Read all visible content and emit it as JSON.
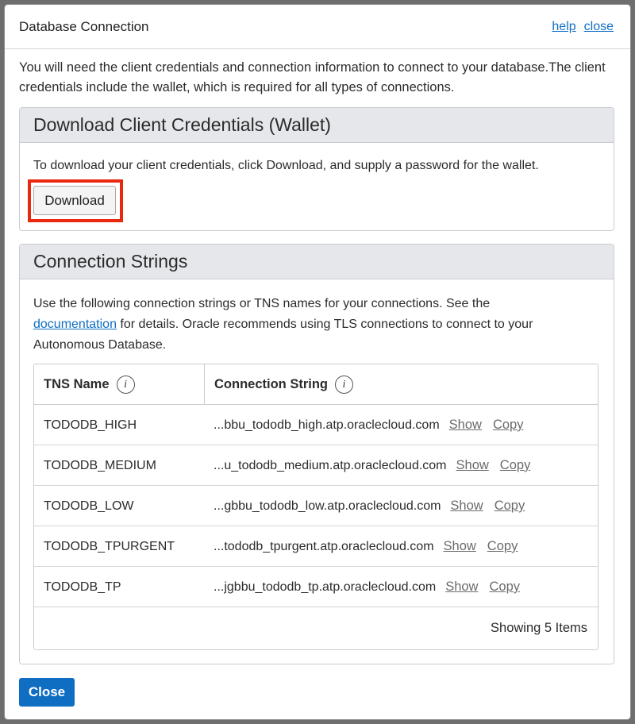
{
  "dialog": {
    "title": "Database Connection",
    "help_link": "help",
    "close_link": "close",
    "intro": "You will need the client credentials and connection information to connect to your database.The client credentials include the wallet, which is required for all types of connections."
  },
  "wallet_panel": {
    "heading": "Download Client Credentials (Wallet)",
    "text": "To download your client credentials, click Download, and supply a password for the wallet.",
    "download_label": "Download"
  },
  "conn_panel": {
    "heading": "Connection Strings",
    "text_before": "Use the following connection strings or TNS names for your connections. See the",
    "doc_link": "documentation",
    "text_after": "for details. Oracle recommends using TLS connections to connect to your Autonomous Database.",
    "columns": {
      "tns_name": "TNS Name",
      "connection_string": "Connection String"
    },
    "info_icon_glyph": "i",
    "rows": [
      {
        "name": "TODODB_HIGH",
        "conn": "...bbu_tododb_high.atp.oraclecloud.com",
        "show": "Show",
        "copy": "Copy"
      },
      {
        "name": "TODODB_MEDIUM",
        "conn": "...u_tododb_medium.atp.oraclecloud.com",
        "show": "Show",
        "copy": "Copy"
      },
      {
        "name": "TODODB_LOW",
        "conn": "...gbbu_tododb_low.atp.oraclecloud.com",
        "show": "Show",
        "copy": "Copy"
      },
      {
        "name": "TODODB_TPURGENT",
        "conn": "...tododb_tpurgent.atp.oraclecloud.com",
        "show": "Show",
        "copy": "Copy"
      },
      {
        "name": "TODODB_TP",
        "conn": "...jgbbu_tododb_tp.atp.oraclecloud.com",
        "show": "Show",
        "copy": "Copy"
      }
    ],
    "footer": "Showing 5 Items"
  },
  "footer": {
    "close_button": "Close"
  },
  "colors": {
    "accent": "#0f6ec2",
    "highlight_box": "#e8280f",
    "panel_header_bg": "#e5e7ea"
  }
}
